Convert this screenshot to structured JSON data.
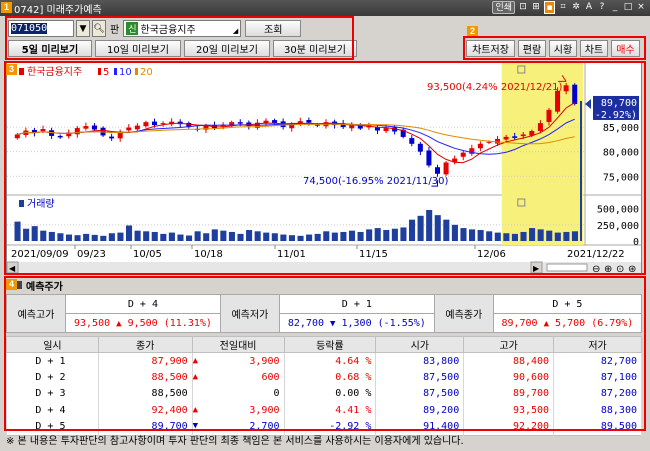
{
  "window": {
    "title": "0742] 미래주가예측",
    "icons": [
      "인쇄",
      "?",
      "A",
      "_",
      "□",
      "×"
    ]
  },
  "search": {
    "code": "071050",
    "code_tag": "판",
    "sin_label": "신",
    "stock_name": "한국금융지주",
    "query_button": "조회"
  },
  "preview_tabs": [
    "5일 미리보기",
    "10일 미리보기",
    "20일 미리보기",
    "30분 미리보기"
  ],
  "actions": [
    "차트저장",
    "편람",
    "시황",
    "차트",
    "매수"
  ],
  "badges": [
    "1",
    "2",
    "3",
    "4"
  ],
  "chart": {
    "legend": {
      "name": "한국금융지주",
      "ma5": "5",
      "ma10": "10",
      "ma20": "20"
    },
    "high_annotation": "93,500(4.24% 2021/12/21)",
    "low_annotation": "74,500(-16.95% 2021/11/30)",
    "price_axis": [
      "85,000",
      "80,000",
      "75,000"
    ],
    "current_price": "89,700",
    "current_change": "(-2.92%)",
    "volume_label": "거래량",
    "volume_axis": [
      "500,000",
      "250,000",
      "0"
    ],
    "dates": [
      "2021/09/09",
      "09/23",
      "10/05",
      "10/18",
      "11/01",
      "11/15",
      "12/06",
      "2021/12/22"
    ],
    "colors": {
      "up": "#e60000",
      "down": "#0000d0",
      "highlight": "#f7f07a",
      "ma5": "#e00000",
      "ma10": "#2222ff",
      "ma20": "#e08a00"
    }
  },
  "chart_data": {
    "type": "candlestick",
    "title": "한국금융지주",
    "price_ylim": [
      72000,
      96000
    ],
    "volume_ylim": [
      0,
      650000
    ],
    "x_labels": [
      "2021/09/09",
      "09/23",
      "10/05",
      "10/18",
      "11/01",
      "11/15",
      "12/06",
      "2021/12/22"
    ],
    "close": [
      83500,
      84300,
      83800,
      84600,
      83200,
      82900,
      83900,
      84800,
      85200,
      84500,
      83300,
      82700,
      84100,
      84900,
      85300,
      86000,
      85400,
      85800,
      86100,
      85600,
      85000,
      84600,
      85300,
      84800,
      85500,
      86000,
      85700,
      85200,
      85900,
      86300,
      85800,
      85000,
      85600,
      86200,
      85900,
      85300,
      86000,
      85400,
      85000,
      85500,
      84700,
      85300,
      84300,
      84800,
      84100,
      83000,
      81600,
      80000,
      77200,
      75500,
      77800,
      78600,
      79800,
      80700,
      81600,
      82000,
      82600,
      83000,
      82800,
      83500,
      84200,
      85800,
      88500,
      92400,
      93500,
      89700
    ],
    "volume": [
      300000,
      190000,
      230000,
      160000,
      140000,
      120000,
      100000,
      90000,
      110000,
      95000,
      80000,
      120000,
      130000,
      240000,
      160000,
      150000,
      140000,
      110000,
      130000,
      100000,
      85000,
      150000,
      120000,
      180000,
      160000,
      140000,
      110000,
      170000,
      150000,
      130000,
      120000,
      100000,
      90000,
      80000,
      100000,
      110000,
      150000,
      130000,
      140000,
      160000,
      140000,
      180000,
      200000,
      170000,
      190000,
      210000,
      330000,
      390000,
      480000,
      400000,
      330000,
      250000,
      200000,
      180000,
      170000,
      150000,
      130000,
      120000,
      110000,
      140000,
      200000,
      180000,
      160000,
      130000,
      140000,
      150000
    ],
    "series": [
      {
        "name": "5"
      },
      {
        "name": "10"
      },
      {
        "name": "20"
      }
    ]
  },
  "forecast_summary": {
    "title": "예측주가",
    "labels": [
      "예측고가",
      "예측저가",
      "예측종가"
    ],
    "heads": [
      "D + 4",
      "D + 1",
      "D + 5"
    ],
    "values": [
      {
        "price": "93,500",
        "change": "9,500",
        "rate": "(11.31%)"
      },
      {
        "price": "82,700",
        "change": "1,300",
        "rate": "(-1.55%)"
      },
      {
        "price": "89,700",
        "change": "5,700",
        "rate": "(6.79%)"
      }
    ]
  },
  "forecast_table": {
    "headers": [
      "일시",
      "종가",
      "전일대비",
      "등락률",
      "시가",
      "고가",
      "저가"
    ],
    "rows": [
      {
        "day": "D + 1",
        "close": "87,900",
        "dir": "up",
        "diff": "3,900",
        "rate": "4.64 %",
        "open": "83,800",
        "high": "88,400",
        "low": "82,700"
      },
      {
        "day": "D + 2",
        "close": "88,500",
        "dir": "up",
        "diff": "600",
        "rate": "0.68 %",
        "open": "87,500",
        "high": "90,600",
        "low": "87,100"
      },
      {
        "day": "D + 3",
        "close": "88,500",
        "dir": "flat",
        "diff": "0",
        "rate": "0.00 %",
        "open": "87,500",
        "high": "89,700",
        "low": "87,200"
      },
      {
        "day": "D + 4",
        "close": "92,400",
        "dir": "up",
        "diff": "3,900",
        "rate": "4.41 %",
        "open": "89,200",
        "high": "93,500",
        "low": "88,300"
      },
      {
        "day": "D + 5",
        "close": "89,700",
        "dir": "down",
        "diff": "2,700",
        "rate": "-2.92 %",
        "open": "91,400",
        "high": "92,200",
        "low": "89,500"
      }
    ]
  },
  "footer": "※ 본 내용은 투자판단의 참고사항이며 투자 판단의 최종 책임은 본 서비스를 사용하시는 이용자에게 있습니다."
}
